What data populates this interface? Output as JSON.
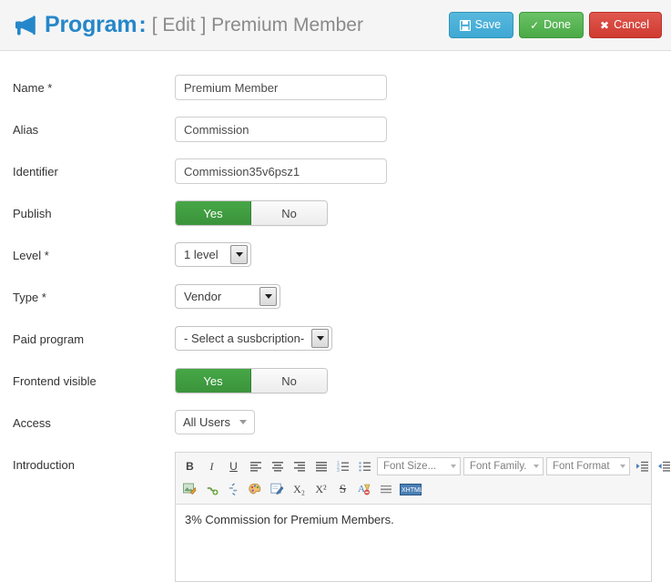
{
  "header": {
    "icon": "megaphone-icon",
    "title": "Program",
    "separator": ":",
    "subtitle": "[ Edit ] Premium Member",
    "accent_color": "#2587c9",
    "buttons": [
      {
        "label": "Save",
        "icon": "floppy-disk-icon",
        "color": "#3ea8d4"
      },
      {
        "label": "Done",
        "icon": "check-icon",
        "color": "#4aa946"
      },
      {
        "label": "Cancel",
        "icon": "cross-icon",
        "color": "#cf3a30"
      }
    ]
  },
  "form": {
    "name": {
      "label": "Name *",
      "value": "Premium Member"
    },
    "alias": {
      "label": "Alias",
      "value": "Commission"
    },
    "identifier": {
      "label": "Identifier",
      "value": "Commission35v6psz1"
    },
    "publish": {
      "label": "Publish",
      "yes": "Yes",
      "no": "No",
      "selected": "Yes"
    },
    "level": {
      "label": "Level *",
      "value": "1 level"
    },
    "type": {
      "label": "Type *",
      "value": "Vendor"
    },
    "paid_program": {
      "label": "Paid program",
      "value": "- Select a susbcription-"
    },
    "frontend_visible": {
      "label": "Frontend visible",
      "yes": "Yes",
      "no": "No",
      "selected": "Yes"
    },
    "access": {
      "label": "Access",
      "value": "All Users"
    },
    "introduction": {
      "label": "Introduction",
      "body": "3% Commission for Premium Members."
    }
  },
  "editor": {
    "toolbar_row1": [
      {
        "name": "bold-icon",
        "glyph": "B"
      },
      {
        "name": "italic-icon",
        "glyph": "I"
      },
      {
        "name": "underline-icon",
        "glyph": "U"
      },
      {
        "name": "align-left-icon",
        "glyph": "≡"
      },
      {
        "name": "align-center-icon",
        "glyph": "≡"
      },
      {
        "name": "align-right-icon",
        "glyph": "≡"
      },
      {
        "name": "align-justify-icon",
        "glyph": "≡"
      },
      {
        "name": "numbered-list-icon",
        "glyph": "☰"
      },
      {
        "name": "bulleted-list-icon",
        "glyph": "☰"
      }
    ],
    "combos": [
      {
        "name": "font-size-select",
        "label": "Font Size..."
      },
      {
        "name": "font-family-select",
        "label": "Font Family."
      },
      {
        "name": "font-format-select",
        "label": "Font Format"
      }
    ],
    "indent_buttons": [
      {
        "name": "indent-increase-icon"
      },
      {
        "name": "indent-decrease-icon"
      }
    ],
    "toolbar_row2": [
      {
        "name": "insert-image-icon"
      },
      {
        "name": "insert-link-icon"
      },
      {
        "name": "unlink-icon"
      },
      {
        "name": "text-color-palette-icon"
      },
      {
        "name": "background-color-icon"
      },
      {
        "name": "subscript-icon",
        "glyph": "X₂"
      },
      {
        "name": "superscript-icon",
        "glyph": "X²"
      },
      {
        "name": "strikethrough-icon",
        "glyph": "S"
      },
      {
        "name": "remove-format-icon"
      },
      {
        "name": "horizontal-rule-icon"
      },
      {
        "name": "html-source-icon",
        "glyph": "XHTML"
      }
    ]
  }
}
